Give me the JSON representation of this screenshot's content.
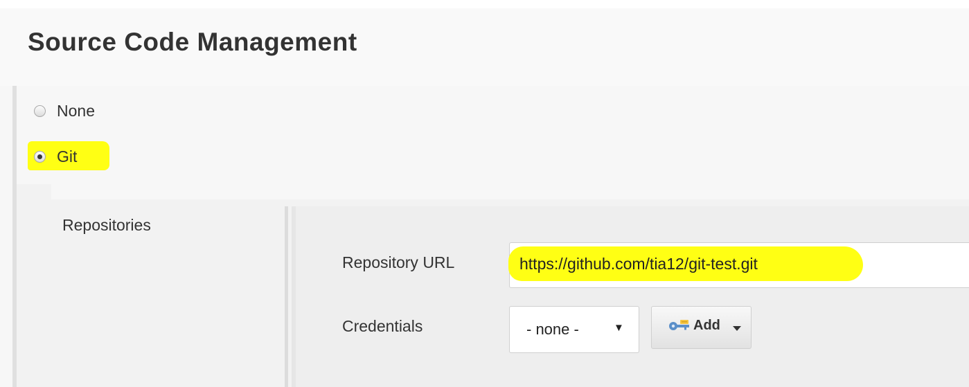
{
  "section": {
    "title": "Source Code Management"
  },
  "scm_options": [
    {
      "label": "None",
      "selected": false
    },
    {
      "label": "Git",
      "selected": true
    }
  ],
  "repositories": {
    "label": "Repositories",
    "url_label": "Repository URL",
    "url_value": "https://github.com/tia12/git-test.git",
    "credentials_label": "Credentials",
    "credentials_selected": "- none -",
    "add_button_label": "Add"
  },
  "highlight_color": "#ffff14",
  "icons": {
    "credentials_add": "key-icon",
    "add_dropdown": "caret-down-icon",
    "select_dropdown": "triangle-down-icon"
  }
}
